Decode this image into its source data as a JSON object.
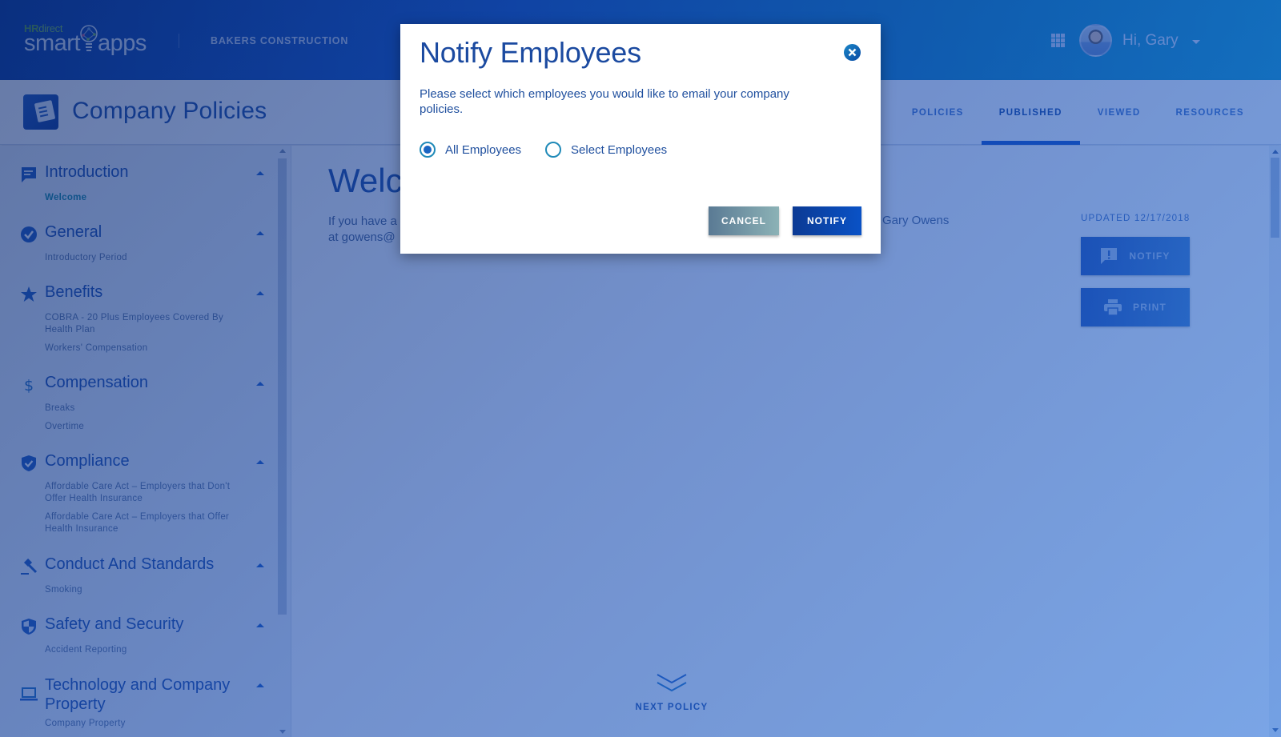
{
  "header": {
    "logo": {
      "hr": "HR",
      "direct": "direct",
      "smart": "smart",
      "apps": "apps"
    },
    "company": "BAKERS CONSTRUCTION",
    "greeting": "Hi, Gary"
  },
  "subheader": {
    "title": "Company Policies",
    "tabs": [
      {
        "label": "POLICIES",
        "active": false
      },
      {
        "label": "PUBLISHED",
        "active": true
      },
      {
        "label": "VIEWED",
        "active": false
      },
      {
        "label": "RESOURCES",
        "active": false
      }
    ]
  },
  "sidebar": {
    "sections": [
      {
        "title": "Introduction",
        "icon": "chat-bubble-icon",
        "items": [
          "Welcome"
        ],
        "active_item": "Welcome"
      },
      {
        "title": "General",
        "icon": "check-circle-icon",
        "items": [
          "Introductory Period"
        ]
      },
      {
        "title": "Benefits",
        "icon": "star-icon",
        "items": [
          "COBRA - 20 Plus Employees Covered By Health Plan",
          "Workers' Compensation"
        ]
      },
      {
        "title": "Compensation",
        "icon": "dollar-icon",
        "items": [
          "Breaks",
          "Overtime"
        ]
      },
      {
        "title": "Compliance",
        "icon": "shield-check-icon",
        "items": [
          "Affordable Care Act – Employers that Don't Offer Health Insurance",
          "Affordable Care Act – Employers that Offer Health Insurance"
        ]
      },
      {
        "title": "Conduct And Standards",
        "icon": "gavel-icon",
        "items": [
          "Smoking"
        ]
      },
      {
        "title": "Safety and Security",
        "icon": "security-shield-icon",
        "items": [
          "Accident Reporting"
        ]
      },
      {
        "title": "Technology and Company Property",
        "icon": "laptop-icon",
        "items": [
          "Company Property"
        ]
      }
    ]
  },
  "main": {
    "welcome_heading": "Welc",
    "intro_line1": "If you have a",
    "intro_line2": "at gowens@",
    "intro_right": "Gary Owens",
    "updated": "UPDATED 12/17/2018",
    "notify_label": "NOTIFY",
    "print_label": "PRINT",
    "next_policy": "NEXT POLICY"
  },
  "modal": {
    "title": "Notify Employees",
    "description": "Please select which employees you would like to email your company policies.",
    "options": [
      {
        "label": "All Employees",
        "checked": true
      },
      {
        "label": "Select Employees",
        "checked": false
      }
    ],
    "cancel_label": "CANCEL",
    "notify_label": "NOTIFY"
  }
}
